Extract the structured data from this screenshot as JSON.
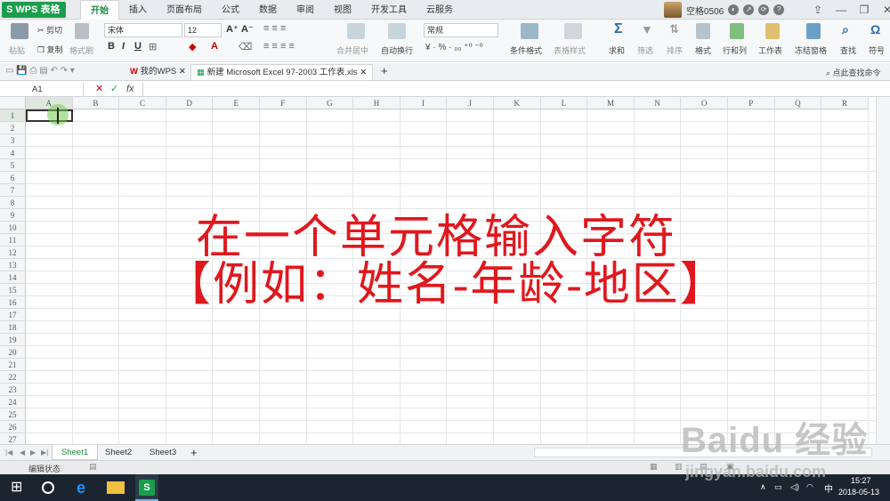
{
  "app": {
    "name": "WPS 表格"
  },
  "menu": {
    "tabs": [
      "开始",
      "插入",
      "页面布局",
      "公式",
      "数据",
      "审阅",
      "视图",
      "开发工具",
      "云服务"
    ]
  },
  "user": {
    "name": "空格0506",
    "icons": [
      "minimize-ribbon-icon",
      "skin-icon",
      "help-icon"
    ]
  },
  "ribbon": {
    "paste": "粘贴",
    "cut": "剪切",
    "copy": "复制",
    "format_painter": "格式刷",
    "font_name": "宋体",
    "font_size": "12",
    "merge_center": "合并居中",
    "wrap_text": "自动换行",
    "number_format": "常规",
    "conditional_format": "条件格式",
    "table_style": "表格样式",
    "sum": "求和",
    "filter": "筛选",
    "sort": "排序",
    "format": "格式",
    "rows_cols": "行和列",
    "worksheet": "工作表",
    "freeze": "冻结窗格",
    "find": "查找",
    "symbol": "符号"
  },
  "doctabs": {
    "home": "我的WPS",
    "file": "新建 Microsoft Excel 97-2003 工作表.xls",
    "search": "点此查找命令"
  },
  "formula": {
    "cell_ref": "A1",
    "fx": "fx"
  },
  "columns": [
    "A",
    "B",
    "C",
    "D",
    "E",
    "F",
    "G",
    "H",
    "I",
    "J",
    "K",
    "L",
    "M",
    "N",
    "O",
    "P",
    "Q",
    "R"
  ],
  "rows": [
    "1",
    "2",
    "3",
    "4",
    "5",
    "6",
    "7",
    "8",
    "9",
    "10",
    "11",
    "12",
    "13",
    "14",
    "15",
    "16",
    "17",
    "18",
    "19",
    "20",
    "21",
    "22",
    "23",
    "24",
    "25",
    "26",
    "27"
  ],
  "overlay": {
    "line1": "在一个单元格输入字符",
    "line2": "【例如：姓名-年龄-地区】"
  },
  "sheets": [
    "Sheet1",
    "Sheet2",
    "Sheet3"
  ],
  "status": {
    "mode": "编辑状态"
  },
  "taskbar": {
    "time": "15:27",
    "date": "2018-05-13",
    "ime": "中"
  },
  "watermark": {
    "brand": "Baidu 经验",
    "url": "jingyan.baidu.com"
  },
  "colors": {
    "accent": "#1a9e4b",
    "overlay_text": "#e0181e",
    "taskbar": "#1b2530"
  }
}
